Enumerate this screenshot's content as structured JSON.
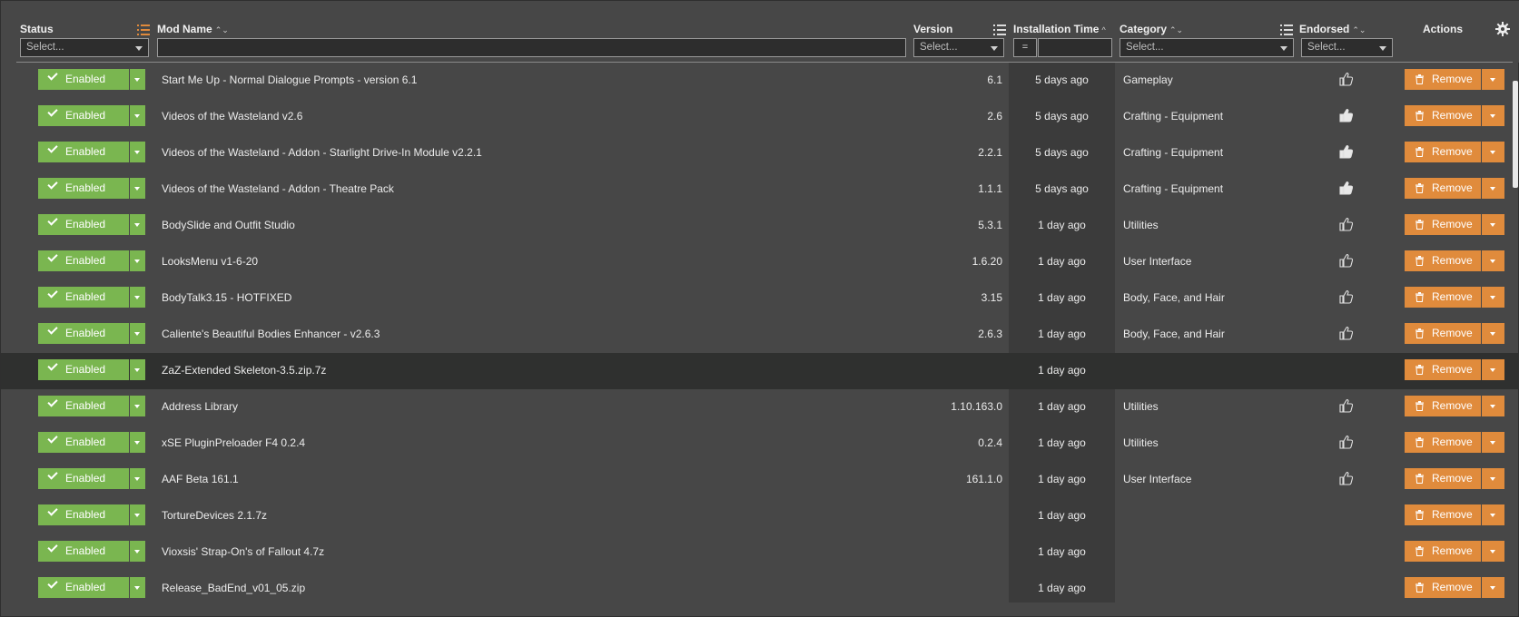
{
  "header": {
    "status": "Status",
    "mod_name": "Mod Name",
    "version": "Version",
    "installation_time": "Installation Time",
    "category": "Category",
    "endorsed": "Endorsed",
    "actions": "Actions",
    "sort_both": "⌃⌄",
    "sort_up": "^"
  },
  "filters": {
    "status_placeholder": "Select...",
    "version_placeholder": "Select...",
    "installation_operator": "=",
    "category_placeholder": "Select...",
    "endorsed_placeholder": "Select..."
  },
  "icons": {
    "settings": "gear-icon",
    "column_chooser": "list-icon",
    "endorse": "thumbs-up-icon",
    "remove": "trash-icon",
    "enabled": "check-icon"
  },
  "colors": {
    "enabled_button": "#7ab650",
    "remove_button": "#e08b3c",
    "background": "#474747",
    "selected_row": "#2f302f"
  },
  "rows": [
    {
      "status": "Enabled",
      "name": "Start Me Up - Normal Dialogue Prompts - version 6.1",
      "version": "6.1",
      "time": "5 days ago",
      "category": "Gameplay",
      "endorsed": "outline",
      "action": "Remove"
    },
    {
      "status": "Enabled",
      "name": "Videos of the Wasteland v2.6",
      "version": "2.6",
      "time": "5 days ago",
      "category": "Crafting - Equipment",
      "endorsed": "filled",
      "action": "Remove"
    },
    {
      "status": "Enabled",
      "name": "Videos of the Wasteland - Addon - Starlight Drive-In Module v2.2.1",
      "version": "2.2.1",
      "time": "5 days ago",
      "category": "Crafting - Equipment",
      "endorsed": "filled",
      "action": "Remove"
    },
    {
      "status": "Enabled",
      "name": "Videos of the Wasteland - Addon - Theatre Pack",
      "version": "1.1.1",
      "time": "5 days ago",
      "category": "Crafting - Equipment",
      "endorsed": "filled",
      "action": "Remove"
    },
    {
      "status": "Enabled",
      "name": "BodySlide and Outfit Studio",
      "version": "5.3.1",
      "time": "1 day ago",
      "category": "Utilities",
      "endorsed": "outline",
      "action": "Remove"
    },
    {
      "status": "Enabled",
      "name": "LooksMenu v1-6-20",
      "version": "1.6.20",
      "time": "1 day ago",
      "category": "User Interface",
      "endorsed": "outline",
      "action": "Remove"
    },
    {
      "status": "Enabled",
      "name": "BodyTalk3.15 - HOTFIXED",
      "version": "3.15",
      "time": "1 day ago",
      "category": "Body, Face, and Hair",
      "endorsed": "outline",
      "action": "Remove"
    },
    {
      "status": "Enabled",
      "name": "Caliente's Beautiful Bodies Enhancer - v2.6.3",
      "version": "2.6.3",
      "time": "1 day ago",
      "category": "Body, Face, and Hair",
      "endorsed": "outline",
      "action": "Remove"
    },
    {
      "status": "Enabled",
      "name": "ZaZ-Extended Skeleton-3.5.zip.7z",
      "version": "",
      "time": "1 day ago",
      "category": "",
      "endorsed": "none",
      "action": "Remove",
      "selected": true
    },
    {
      "status": "Enabled",
      "name": "Address Library",
      "version": "1.10.163.0",
      "time": "1 day ago",
      "category": "Utilities",
      "endorsed": "outline",
      "action": "Remove"
    },
    {
      "status": "Enabled",
      "name": "xSE PluginPreloader F4 0.2.4",
      "version": "0.2.4",
      "time": "1 day ago",
      "category": "Utilities",
      "endorsed": "outline",
      "action": "Remove"
    },
    {
      "status": "Enabled",
      "name": "AAF Beta 161.1",
      "version": "161.1.0",
      "time": "1 day ago",
      "category": "User Interface",
      "endorsed": "outline",
      "action": "Remove"
    },
    {
      "status": "Enabled",
      "name": "TortureDevices 2.1.7z",
      "version": "",
      "time": "1 day ago",
      "category": "",
      "endorsed": "none",
      "action": "Remove"
    },
    {
      "status": "Enabled",
      "name": "Vioxsis' Strap-On's of Fallout 4.7z",
      "version": "",
      "time": "1 day ago",
      "category": "",
      "endorsed": "none",
      "action": "Remove"
    },
    {
      "status": "Enabled",
      "name": "Release_BadEnd_v01_05.zip",
      "version": "",
      "time": "1 day ago",
      "category": "",
      "endorsed": "none",
      "action": "Remove"
    }
  ]
}
